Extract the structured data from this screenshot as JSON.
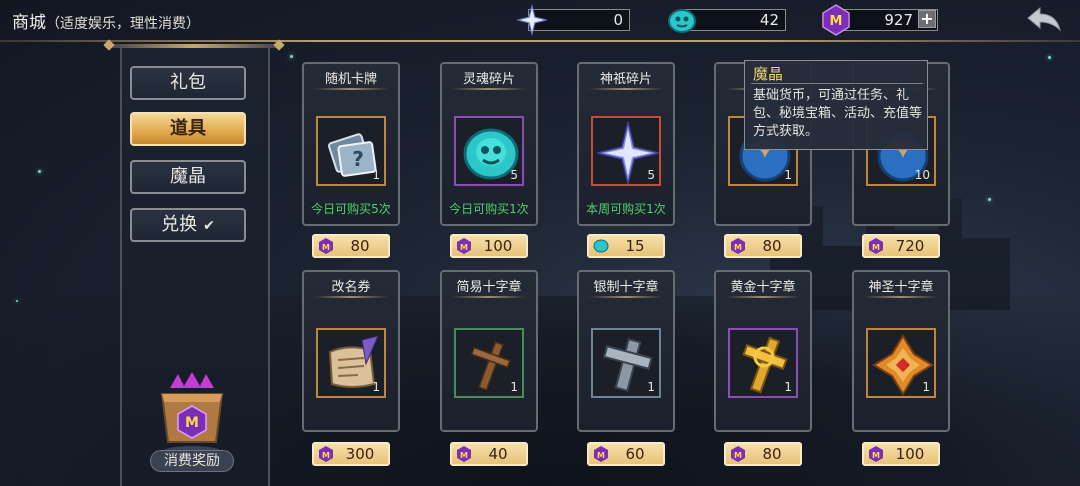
{
  "header": {
    "title": "商城",
    "subtitle": "（适度娱乐，理性消费）"
  },
  "currencies": [
    {
      "icon": "star-shard-icon",
      "value": "0"
    },
    {
      "icon": "soul-stone-icon",
      "value": "42"
    },
    {
      "icon": "magic-crystal-icon",
      "value": "927"
    }
  ],
  "sidebar": {
    "items": [
      {
        "label": "礼包"
      },
      {
        "label": "道具",
        "active": true
      },
      {
        "label": "魔晶"
      },
      {
        "label": "兑换"
      }
    ],
    "reward_label": "消费奖励"
  },
  "items": [
    {
      "name": "随机卡牌",
      "qty": "1",
      "limit": "今日可购买5次",
      "price": "80",
      "price_icon": "magic-crystal-icon"
    },
    {
      "name": "灵魂碎片",
      "qty": "5",
      "limit": "今日可购买1次",
      "price": "100",
      "price_icon": "magic-crystal-icon"
    },
    {
      "name": "神祇碎片",
      "qty": "5",
      "limit": "本周可购买1次",
      "price": "15",
      "price_icon": "soul-stone-icon"
    },
    {
      "name": "",
      "qty": "1",
      "limit": "",
      "price": "80",
      "price_icon": "magic-crystal-icon"
    },
    {
      "name": "",
      "qty": "10",
      "limit": "",
      "price": "720",
      "price_icon": "magic-crystal-icon"
    },
    {
      "name": "改名券",
      "qty": "1",
      "limit": "",
      "price": "300",
      "price_icon": "magic-crystal-icon"
    },
    {
      "name": "简易十字章",
      "qty": "1",
      "limit": "",
      "price": "40",
      "price_icon": "magic-crystal-icon"
    },
    {
      "name": "银制十字章",
      "qty": "1",
      "limit": "",
      "price": "60",
      "price_icon": "magic-crystal-icon"
    },
    {
      "name": "黄金十字章",
      "qty": "1",
      "limit": "",
      "price": "80",
      "price_icon": "magic-crystal-icon"
    },
    {
      "name": "神圣十字章",
      "qty": "1",
      "limit": "",
      "price": "100",
      "price_icon": "magic-crystal-icon"
    }
  ],
  "tooltip": {
    "title": "魔晶",
    "body": "基础货币，可通过任务、礼包、秘境宝箱、活动、充值等方式获取。"
  },
  "colors": {
    "active_tab": "#e0a94a",
    "limit_text": "#4fd06b",
    "price_bg": "#f5dfa8",
    "tooltip_title": "#f0d070"
  }
}
